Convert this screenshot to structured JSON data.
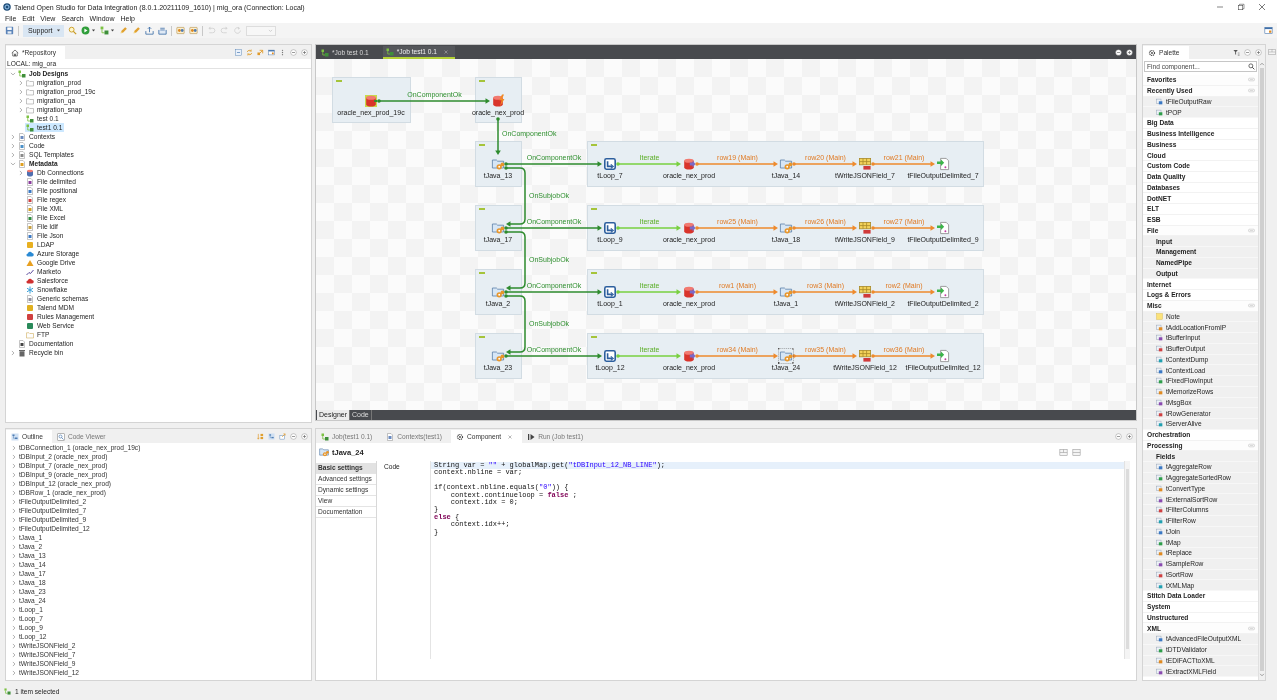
{
  "window": {
    "title": "Talend Open Studio for Data Integration (8.0.1.20211109_1610) | mig_ora (Connection: Local)"
  },
  "menu": [
    "File",
    "Edit",
    "View",
    "Search",
    "Window",
    "Help"
  ],
  "toolbar": [
    {
      "kind": "save",
      "disabled": false
    },
    {
      "kind": "support",
      "label": "Support",
      "disabled": false
    },
    {
      "kind": "search",
      "disabled": false
    },
    {
      "kind": "run",
      "disabled": false
    },
    {
      "kind": "job",
      "disabled": false
    },
    {
      "kind": "edit",
      "disabled": false
    },
    {
      "kind": "edit",
      "disabled": false
    },
    {
      "kind": "export",
      "disabled": false
    },
    {
      "kind": "import",
      "disabled": false
    },
    {
      "kind": "component",
      "disabled": false
    },
    {
      "kind": "component",
      "disabled": false
    },
    {
      "kind": "undo",
      "disabled": true
    },
    {
      "kind": "redo",
      "disabled": true
    },
    {
      "kind": "reload",
      "disabled": true
    },
    {
      "kind": "combo",
      "disabled": true
    }
  ],
  "repository": {
    "tabs": [
      {
        "label": "*Repository",
        "kind": "home",
        "selected": true
      }
    ],
    "connection": "LOCAL: mig_ora",
    "tree": [
      {
        "label": "Job Designs",
        "kind": "jobs",
        "expanded": true,
        "selected": false,
        "children": [
          {
            "label": "migration_prod",
            "kind": "folder",
            "expanded": false,
            "selected": false
          },
          {
            "label": "migration_prod_19c",
            "kind": "folder",
            "expanded": false,
            "selected": false
          },
          {
            "label": "migration_qa",
            "kind": "folder",
            "expanded": false,
            "selected": false
          },
          {
            "label": "migration_snap",
            "kind": "folder",
            "expanded": false,
            "selected": false
          },
          {
            "label": "test 0.1",
            "kind": "job",
            "selected": false
          },
          {
            "label": "test1 0.1",
            "kind": "job",
            "selected": true
          }
        ]
      },
      {
        "label": "Contexts",
        "kind": "contexts",
        "expanded": false,
        "selected": false
      },
      {
        "label": "Code",
        "kind": "code",
        "expanded": false,
        "selected": false
      },
      {
        "label": "SQL Templates",
        "kind": "sql",
        "expanded": false,
        "selected": false
      },
      {
        "label": "Metadata",
        "kind": "metadata",
        "expanded": true,
        "selected": false,
        "children": [
          {
            "label": "Db Connections",
            "kind": "db",
            "expanded": false,
            "selected": false
          },
          {
            "label": "File delimited",
            "kind": "delimited",
            "selected": false
          },
          {
            "label": "File positional",
            "kind": "positional",
            "selected": false
          },
          {
            "label": "File regex",
            "kind": "regex",
            "selected": false
          },
          {
            "label": "File XML",
            "kind": "xml",
            "selected": false
          },
          {
            "label": "File Excel",
            "kind": "excel",
            "selected": false
          },
          {
            "label": "File ldif",
            "kind": "ldif",
            "selected": false
          },
          {
            "label": "File Json",
            "kind": "json",
            "selected": false
          },
          {
            "label": "LDAP",
            "kind": "ldap",
            "selected": false
          },
          {
            "label": "Azure Storage",
            "kind": "azure",
            "selected": false
          },
          {
            "label": "Google Drive",
            "kind": "gdrive",
            "selected": false
          },
          {
            "label": "Marketo",
            "kind": "marketo",
            "selected": false
          },
          {
            "label": "Salesforce",
            "kind": "salesforce",
            "selected": false
          },
          {
            "label": "Snowflake",
            "kind": "snowflake",
            "selected": false
          },
          {
            "label": "Generic schemas",
            "kind": "schema",
            "selected": false
          },
          {
            "label": "Talend MDM",
            "kind": "mdm",
            "selected": false
          },
          {
            "label": "Rules Management",
            "kind": "rules",
            "selected": false
          },
          {
            "label": "Web Service",
            "kind": "webservice",
            "selected": false
          },
          {
            "label": "FTP",
            "kind": "ftp",
            "selected": false
          }
        ]
      },
      {
        "label": "Documentation",
        "kind": "docs",
        "selected": false
      },
      {
        "label": "Recycle bin",
        "kind": "bin",
        "expanded": false,
        "selected": false
      }
    ]
  },
  "outline": {
    "tabs": [
      {
        "label": "Outline",
        "kind": "outline",
        "selected": true
      },
      {
        "label": "Code Viewer",
        "kind": "viewer",
        "selected": false
      }
    ],
    "items": [
      {
        "label": "tDBConnection_1 (oracle_nex_prod_19c)",
        "expanded": false
      },
      {
        "label": "tDBInput_2 (oracle_nex_prod)",
        "expanded": false
      },
      {
        "label": "tDBInput_7 (oracle_nex_prod)",
        "expanded": false
      },
      {
        "label": "tDBInput_9 (oracle_nex_prod)",
        "expanded": false
      },
      {
        "label": "tDBInput_12 (oracle_nex_prod)",
        "expanded": false
      },
      {
        "label": "tDBRow_1 (oracle_nex_prod)",
        "expanded": false
      },
      {
        "label": "tFileOutputDelimited_2",
        "expanded": false
      },
      {
        "label": "tFileOutputDelimited_7",
        "expanded": false
      },
      {
        "label": "tFileOutputDelimited_9",
        "expanded": false
      },
      {
        "label": "tFileOutputDelimited_12",
        "expanded": false
      },
      {
        "label": "tJava_1",
        "expanded": false
      },
      {
        "label": "tJava_2",
        "expanded": false
      },
      {
        "label": "tJava_13",
        "expanded": false
      },
      {
        "label": "tJava_14",
        "expanded": false
      },
      {
        "label": "tJava_17",
        "expanded": false
      },
      {
        "label": "tJava_18",
        "expanded": false
      },
      {
        "label": "tJava_23",
        "expanded": false
      },
      {
        "label": "tJava_24",
        "expanded": false
      },
      {
        "label": "tLoop_1",
        "expanded": false
      },
      {
        "label": "tLoop_7",
        "expanded": false
      },
      {
        "label": "tLoop_9",
        "expanded": false
      },
      {
        "label": "tLoop_12",
        "expanded": false
      },
      {
        "label": "tWriteJSONField_2",
        "expanded": false
      },
      {
        "label": "tWriteJSONField_7",
        "expanded": false
      },
      {
        "label": "tWriteJSONField_9",
        "expanded": false
      },
      {
        "label": "tWriteJSONField_12",
        "expanded": false
      }
    ]
  },
  "editor": {
    "tabs": [
      {
        "label": "*Job test 0.1",
        "kind": "job",
        "selected": false
      },
      {
        "label": "*Job test1 0.1",
        "kind": "job",
        "selected": true
      }
    ],
    "canvas": {
      "intro": [
        {
          "label": "oracle_nex_prod_19c",
          "kind": "db_connection",
          "selected": false
        },
        {
          "label": "oracle_nex_prod",
          "kind": "db_row",
          "selected": false
        }
      ],
      "intro_link": {
        "label": "OnComponentOk",
        "kind": "trigger"
      },
      "intro_down_link": {
        "label": "OnComponentOk",
        "kind": "trigger"
      },
      "chains": [
        {
          "trigger": {
            "label": "tJava_13",
            "kind": "java",
            "selected": false
          },
          "start_link": {
            "label": "OnComponentOk",
            "kind": "trigger"
          },
          "flow": [
            {
              "label": "tLoop_7",
              "kind": "loop",
              "selected": false
            },
            {
              "label": "oracle_nex_prod",
              "kind": "db_input",
              "selected": false,
              "link_in": {
                "label": "Iterate",
                "kind": "iterate"
              }
            },
            {
              "label": "tJava_14",
              "kind": "java",
              "selected": false,
              "link_in": {
                "label": "row19 (Main)",
                "kind": "main"
              }
            },
            {
              "label": "tWriteJSONField_7",
              "kind": "json_write",
              "selected": false,
              "link_in": {
                "label": "row20 (Main)",
                "kind": "main"
              }
            },
            {
              "label": "tFileOutputDelimited_7",
              "kind": "file_output",
              "selected": false,
              "link_in": {
                "label": "row21 (Main)",
                "kind": "main"
              }
            }
          ],
          "next_link": {
            "label": "OnSubjobOk",
            "kind": "trigger"
          }
        },
        {
          "trigger": {
            "label": "tJava_17",
            "kind": "java",
            "selected": false
          },
          "start_link": {
            "label": "OnComponentOk",
            "kind": "trigger"
          },
          "flow": [
            {
              "label": "tLoop_9",
              "kind": "loop",
              "selected": false
            },
            {
              "label": "oracle_nex_prod",
              "kind": "db_input",
              "selected": false,
              "link_in": {
                "label": "Iterate",
                "kind": "iterate"
              }
            },
            {
              "label": "tJava_18",
              "kind": "java",
              "selected": false,
              "link_in": {
                "label": "row25 (Main)",
                "kind": "main"
              }
            },
            {
              "label": "tWriteJSONField_9",
              "kind": "json_write",
              "selected": false,
              "link_in": {
                "label": "row26 (Main)",
                "kind": "main"
              }
            },
            {
              "label": "tFileOutputDelimited_9",
              "kind": "file_output",
              "selected": false,
              "link_in": {
                "label": "row27 (Main)",
                "kind": "main"
              }
            }
          ],
          "next_link": {
            "label": "OnSubjobOk",
            "kind": "trigger"
          }
        },
        {
          "trigger": {
            "label": "tJava_2",
            "kind": "java",
            "selected": false
          },
          "start_link": {
            "label": "OnComponentOk",
            "kind": "trigger"
          },
          "flow": [
            {
              "label": "tLoop_1",
              "kind": "loop",
              "selected": false
            },
            {
              "label": "oracle_nex_prod",
              "kind": "db_input",
              "selected": false,
              "link_in": {
                "label": "Iterate",
                "kind": "iterate"
              }
            },
            {
              "label": "tJava_1",
              "kind": "java",
              "selected": false,
              "link_in": {
                "label": "row1 (Main)",
                "kind": "main"
              }
            },
            {
              "label": "tWriteJSONField_2",
              "kind": "json_write",
              "selected": false,
              "link_in": {
                "label": "row3 (Main)",
                "kind": "main"
              }
            },
            {
              "label": "tFileOutputDelimited_2",
              "kind": "file_output",
              "selected": false,
              "link_in": {
                "label": "row2 (Main)",
                "kind": "main"
              }
            }
          ],
          "next_link": {
            "label": "OnSubjobOk",
            "kind": "trigger"
          }
        },
        {
          "trigger": {
            "label": "tJava_23",
            "kind": "java",
            "selected": false
          },
          "start_link": {
            "label": "OnComponentOk",
            "kind": "trigger"
          },
          "flow": [
            {
              "label": "tLoop_12",
              "kind": "loop",
              "selected": false
            },
            {
              "label": "oracle_nex_prod",
              "kind": "db_input",
              "selected": false,
              "link_in": {
                "label": "Iterate",
                "kind": "iterate"
              }
            },
            {
              "label": "tJava_24",
              "kind": "java",
              "selected": true,
              "link_in": {
                "label": "row34 (Main)",
                "kind": "main"
              }
            },
            {
              "label": "tWriteJSONField_12",
              "kind": "json_write",
              "selected": false,
              "link_in": {
                "label": "row35 (Main)",
                "kind": "main"
              }
            },
            {
              "label": "tFileOutputDelimited_12",
              "kind": "file_output",
              "selected": false,
              "link_in": {
                "label": "row36 (Main)",
                "kind": "main"
              }
            }
          ]
        }
      ]
    },
    "views": [
      {
        "label": "Designer",
        "selected": true
      },
      {
        "label": "Code",
        "selected": false
      }
    ]
  },
  "properties": {
    "tabs": [
      {
        "label": "Job(test1 0.1)",
        "kind": "job",
        "selected": false
      },
      {
        "label": "Contexts(test1)",
        "kind": "contexts",
        "selected": false
      },
      {
        "label": "Component",
        "kind": "component",
        "selected": true
      },
      {
        "label": "Run (Job test1)",
        "kind": "run",
        "selected": false
      }
    ],
    "component": {
      "label": "tJava_24",
      "kind": "java"
    },
    "sections": [
      {
        "label": "Basic settings",
        "selected": true
      },
      {
        "label": "Advanced settings",
        "selected": false
      },
      {
        "label": "Dynamic settings",
        "selected": false
      },
      {
        "label": "View",
        "selected": false
      },
      {
        "label": "Documentation",
        "selected": false
      }
    ],
    "code": {
      "label": "Code",
      "lines": [
        {
          "kind": "code",
          "current": true,
          "segments": [
            {
              "text": "String var = ",
              "kind": "plain"
            },
            {
              "text": "\"\"",
              "kind": "string"
            },
            {
              "text": " + globalMap.get(",
              "kind": "plain"
            },
            {
              "text": "\"tDBInput_12_NB_LINE\"",
              "kind": "string"
            },
            {
              "text": ");",
              "kind": "plain"
            }
          ]
        },
        {
          "kind": "code",
          "current": false,
          "segments": [
            {
              "text": "context.nbline = var;",
              "kind": "plain"
            }
          ]
        },
        {
          "kind": "blank",
          "current": false
        },
        {
          "kind": "code",
          "current": false,
          "segments": [
            {
              "text": "if(context.nbline.equals(",
              "kind": "plain"
            },
            {
              "text": "\"0\"",
              "kind": "string"
            },
            {
              "text": ")) {",
              "kind": "plain"
            }
          ]
        },
        {
          "kind": "code",
          "current": false,
          "segments": [
            {
              "text": "    context.continueloop = ",
              "kind": "plain"
            },
            {
              "text": "false",
              "kind": "keyword"
            },
            {
              "text": " ;",
              "kind": "plain"
            }
          ]
        },
        {
          "kind": "code",
          "current": false,
          "segments": [
            {
              "text": "    context.idx = 0;",
              "kind": "plain"
            }
          ]
        },
        {
          "kind": "code",
          "current": false,
          "segments": [
            {
              "text": "}",
              "kind": "plain"
            }
          ]
        },
        {
          "kind": "code",
          "current": false,
          "segments": [
            {
              "text": "else",
              "kind": "keyword"
            },
            {
              "text": " {",
              "kind": "plain"
            }
          ]
        },
        {
          "kind": "code",
          "current": false,
          "segments": [
            {
              "text": "    context.idx++;",
              "kind": "plain"
            }
          ]
        },
        {
          "kind": "code",
          "current": false,
          "segments": [
            {
              "text": "}",
              "kind": "plain"
            }
          ]
        }
      ]
    }
  },
  "palette": {
    "tabs": [
      {
        "label": "Palette",
        "kind": "palette",
        "selected": true
      }
    ],
    "search": {
      "placeholder": "Find component..."
    },
    "drawers": [
      {
        "label": "Favorites",
        "expanded": true
      },
      {
        "label": "Recently Used",
        "expanded": true,
        "children": [
          {
            "label": "tFileOutputRaw",
            "kind": "component"
          },
          {
            "label": "tPOP",
            "kind": "component"
          }
        ]
      },
      {
        "label": "Big Data",
        "expanded": false
      },
      {
        "label": "Business Intelligence",
        "expanded": false
      },
      {
        "label": "Business",
        "expanded": false
      },
      {
        "label": "Cloud",
        "expanded": false
      },
      {
        "label": "Custom Code",
        "expanded": false
      },
      {
        "label": "Data Quality",
        "expanded": false
      },
      {
        "label": "Databases",
        "expanded": false
      },
      {
        "label": "DotNET",
        "expanded": false
      },
      {
        "label": "ELT",
        "expanded": false
      },
      {
        "label": "ESB",
        "expanded": false
      },
      {
        "label": "File",
        "expanded": true,
        "children": [
          {
            "label": "Input",
            "kind": "folder"
          },
          {
            "label": "Management",
            "kind": "folder"
          },
          {
            "label": "NamedPipe",
            "kind": "folder"
          },
          {
            "label": "Output",
            "kind": "folder"
          }
        ]
      },
      {
        "label": "Internet",
        "expanded": false
      },
      {
        "label": "Logs & Errors",
        "expanded": false
      },
      {
        "label": "Misc",
        "expanded": true,
        "children": [
          {
            "label": "Note",
            "kind": "note"
          },
          {
            "label": "tAddLocationFromIP",
            "kind": "component"
          },
          {
            "label": "tBufferInput",
            "kind": "component"
          },
          {
            "label": "tBufferOutput",
            "kind": "component"
          },
          {
            "label": "tContextDump",
            "kind": "component"
          },
          {
            "label": "tContextLoad",
            "kind": "component"
          },
          {
            "label": "tFixedFlowInput",
            "kind": "component"
          },
          {
            "label": "tMemorizeRows",
            "kind": "component"
          },
          {
            "label": "tMsgBox",
            "kind": "component"
          },
          {
            "label": "tRowGenerator",
            "kind": "component"
          },
          {
            "label": "tServerAlive",
            "kind": "component"
          }
        ]
      },
      {
        "label": "Orchestration",
        "expanded": false
      },
      {
        "label": "Processing",
        "expanded": true,
        "children": [
          {
            "label": "Fields",
            "kind": "folder"
          },
          {
            "label": "tAggregateRow",
            "kind": "component"
          },
          {
            "label": "tAggregateSortedRow",
            "kind": "component"
          },
          {
            "label": "tConvertType",
            "kind": "component"
          },
          {
            "label": "tExternalSortRow",
            "kind": "component"
          },
          {
            "label": "tFilterColumns",
            "kind": "component"
          },
          {
            "label": "tFilterRow",
            "kind": "component"
          },
          {
            "label": "tJoin",
            "kind": "component"
          },
          {
            "label": "tMap",
            "kind": "component"
          },
          {
            "label": "tReplace",
            "kind": "component"
          },
          {
            "label": "tSampleRow",
            "kind": "component"
          },
          {
            "label": "tSortRow",
            "kind": "component"
          },
          {
            "label": "tXMLMap",
            "kind": "component"
          }
        ]
      },
      {
        "label": "Stitch Data Loader",
        "expanded": false
      },
      {
        "label": "System",
        "expanded": false
      },
      {
        "label": "Unstructured",
        "expanded": false
      },
      {
        "label": "XML",
        "expanded": true,
        "children": [
          {
            "label": "tAdvancedFileOutputXML",
            "kind": "component"
          },
          {
            "label": "tDTDValidator",
            "kind": "component"
          },
          {
            "label": "tEDIFACTtoXML",
            "kind": "component"
          },
          {
            "label": "tExtractXMLField",
            "kind": "component"
          }
        ]
      }
    ]
  },
  "status_bar": {
    "text": "1 item selected"
  }
}
